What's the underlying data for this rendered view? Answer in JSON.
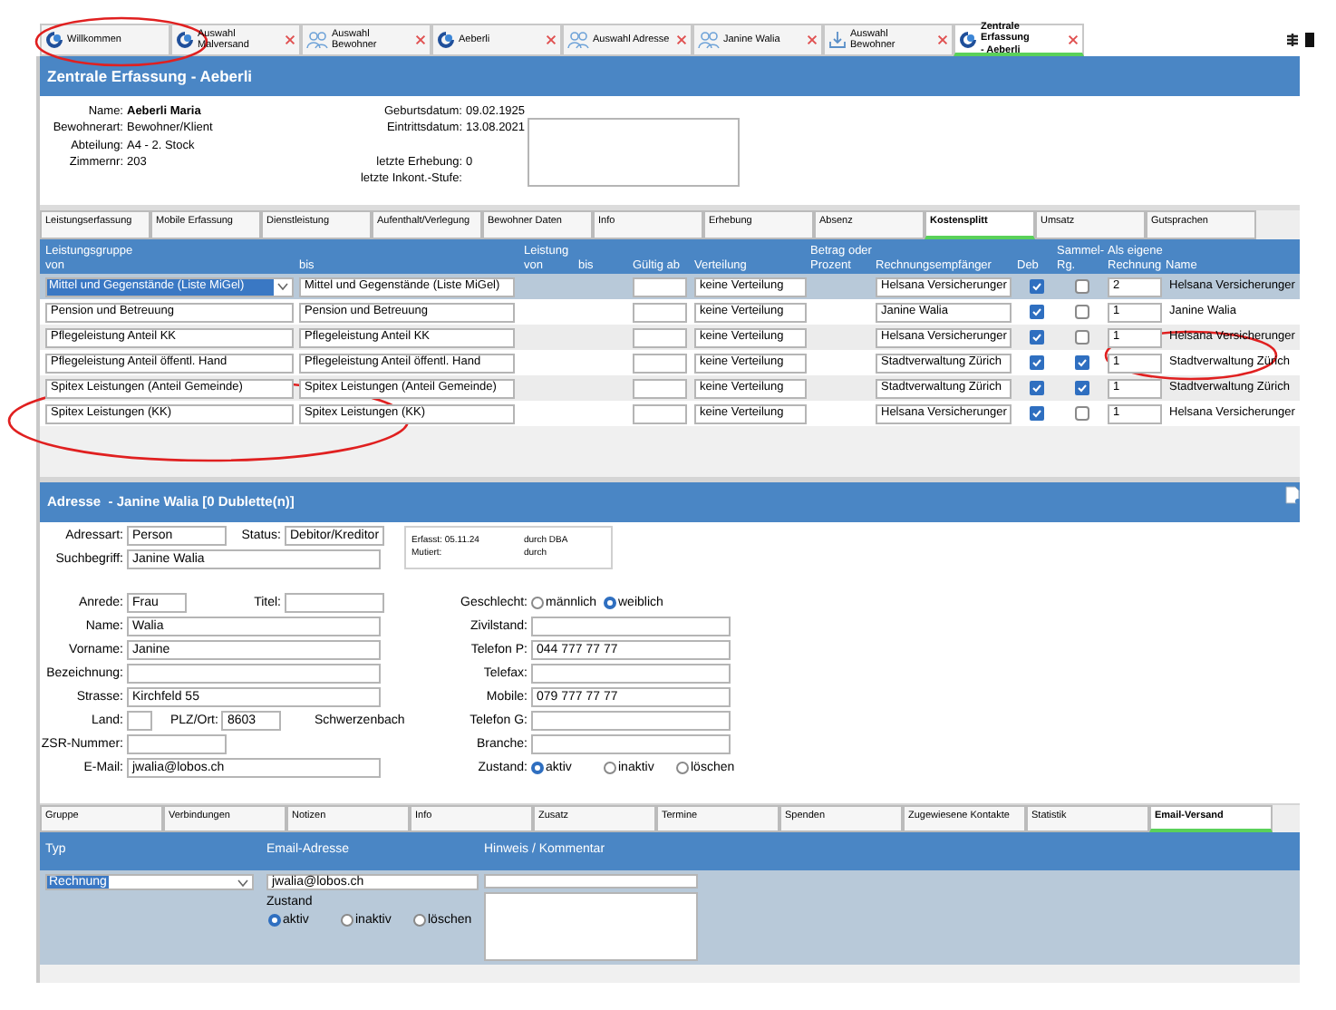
{
  "tabs": [
    {
      "label": "Willkommen",
      "kind": "swirl",
      "closable": false,
      "selected": false
    },
    {
      "label": "Auswahl Malversand",
      "kind": "swirl",
      "closable": true,
      "selected": false
    },
    {
      "label": "Auswahl Bewohner",
      "kind": "people",
      "closable": true,
      "selected": false
    },
    {
      "label": "Aeberli",
      "kind": "swirl",
      "closable": true,
      "selected": false
    },
    {
      "label": "Auswahl Adresse",
      "kind": "people",
      "closable": true,
      "selected": false
    },
    {
      "label": "Janine Walia",
      "kind": "people",
      "closable": true,
      "selected": false
    },
    {
      "label": "Auswahl Bewohner",
      "kind": "arrow",
      "closable": true,
      "selected": false
    },
    {
      "label": "Zentrale Erfassung\n- Aeberli",
      "kind": "swirl",
      "closable": true,
      "selected": true
    }
  ],
  "header": {
    "title": "Zentrale Erfassung - Aeberli",
    "person": [
      {
        "label": "Name:",
        "value": "Aeberli Maria"
      },
      {
        "label": "Bewohnerart:",
        "value": "Bewohner/Klient"
      },
      {
        "label": "Abteilung:",
        "value": "A4 - 2. Stock"
      },
      {
        "label": "Zimmernr:",
        "value": "203"
      }
    ],
    "dates": [
      {
        "label": "Geburtsdatum:",
        "value": "09.02.1925"
      },
      {
        "label": "Eintrittsdatum:",
        "value": "13.08.2021"
      },
      {
        "label": "letzte Erhebung:",
        "value": "0"
      },
      {
        "label": "letzte Inkont.-Stufe:"
      }
    ]
  },
  "subtabs": [
    {
      "label": "Leistungserfassung",
      "selected": false
    },
    {
      "label": "Mobile Erfassung",
      "selected": false
    },
    {
      "label": "Dienstleistung",
      "selected": false
    },
    {
      "label": "Aufenthalt/Verlegung",
      "selected": false
    },
    {
      "label": "Bewohner Daten",
      "selected": false
    },
    {
      "label": "Info",
      "selected": false
    },
    {
      "label": "Erhebung",
      "selected": false
    },
    {
      "label": "Absenz",
      "selected": false
    },
    {
      "label": "Kostensplitt",
      "selected": true
    },
    {
      "label": "Umsatz",
      "selected": false
    },
    {
      "label": "Gutsprachen",
      "selected": false
    }
  ],
  "cost_table": {
    "columns": [
      "Leistungsgruppe\nvon",
      "bis",
      "Leistung\nvon",
      "bis",
      "Gültig ab",
      "Verteilung",
      "Betrag oder\nProzent",
      "Rechnungsempfänger",
      "Deb",
      "Sammel-\nRg.",
      "Als eigene\nRechnung",
      "Name"
    ],
    "rows": [
      {
        "selected": true,
        "von": "Mittel und Gegenstände (Liste MiGel)",
        "bis": "Mittel und Gegenstände (Liste MiGel)",
        "verteilung": "keine Verteilung",
        "empfaenger": "Helsana Versicherunger",
        "deb": true,
        "sammel": false,
        "eigene": "2",
        "name": "Helsana Versicherunger"
      },
      {
        "selected": false,
        "von": "Pension und Betreuung",
        "bis": "Pension und Betreuung",
        "verteilung": "keine Verteilung",
        "empfaenger": "Janine Walia",
        "deb": true,
        "sammel": false,
        "eigene": "1",
        "name": "Janine Walia"
      },
      {
        "selected": false,
        "von": "Pflegeleistung Anteil KK",
        "bis": "Pflegeleistung Anteil KK",
        "verteilung": "keine Verteilung",
        "empfaenger": "Helsana Versicherunger",
        "deb": true,
        "sammel": false,
        "eigene": "1",
        "name": "Helsana Versicherunger"
      },
      {
        "selected": false,
        "von": "Pflegeleistung Anteil öffentl. Hand",
        "bis": "Pflegeleistung Anteil öffentl. Hand",
        "verteilung": "keine Verteilung",
        "empfaenger": "Stadtverwaltung Zürich",
        "deb": true,
        "sammel": true,
        "eigene": "1",
        "name": "Stadtverwaltung Zürich"
      },
      {
        "selected": false,
        "von": "Spitex Leistungen (Anteil Gemeinde)",
        "bis": "Spitex Leistungen (Anteil Gemeinde)",
        "verteilung": "keine Verteilung",
        "empfaenger": "Stadtverwaltung Zürich",
        "deb": true,
        "sammel": true,
        "eigene": "1",
        "name": "Stadtverwaltung Zürich"
      },
      {
        "selected": false,
        "von": "Spitex Leistungen (KK)",
        "bis": "Spitex Leistungen (KK)",
        "verteilung": "keine Verteilung",
        "empfaenger": "Helsana Versicherunger",
        "deb": true,
        "sammel": false,
        "eigene": "1",
        "name": "Helsana Versicherunger"
      }
    ]
  },
  "address": {
    "title": "Adresse  - Janine Walia [0 Dublette(n)]",
    "top_rows": [
      [
        {
          "kind": "field",
          "label": "Adressart:",
          "value": "Person"
        },
        {
          "kind": "field",
          "label": "Status:",
          "value": "Debitor/Kreditor"
        }
      ],
      [
        {
          "kind": "field",
          "label": "Suchbegriff:",
          "value": "Janine Walia"
        }
      ]
    ],
    "meta": [
      {
        "label": "Erfasst: 05.11.24",
        "by": "durch DBA"
      },
      {
        "label": "Mutiert:",
        "by": "durch"
      }
    ],
    "left_rows": [
      [
        {
          "kind": "field",
          "label": "Anrede:",
          "value": "Frau"
        },
        {
          "kind": "field",
          "label": "Titel:"
        }
      ],
      [
        {
          "kind": "field",
          "label": "Name:",
          "value": "Walia"
        }
      ],
      [
        {
          "kind": "field",
          "label": "Vorname:",
          "value": "Janine"
        }
      ],
      [
        {
          "kind": "field",
          "label": "Bezeichnung:"
        }
      ],
      [
        {
          "kind": "field",
          "label": "Strasse:",
          "value": "Kirchfeld 55"
        }
      ],
      [
        {
          "kind": "field",
          "label": "Land:"
        },
        {
          "kind": "field",
          "label": "PLZ/Ort:",
          "value": "8603"
        },
        {
          "kind": "text",
          "value": "Schwerzenbach"
        }
      ],
      [
        {
          "kind": "field",
          "label": "ZSR-Nummer:"
        }
      ],
      [
        {
          "kind": "field",
          "label": "E-Mail:",
          "value": "jwalia@lobos.ch"
        }
      ]
    ],
    "right_rows": [
      {
        "kind": "radio",
        "label": "Geschlecht:",
        "options": [
          {
            "label": "männlich",
            "selected": false
          },
          {
            "label": "weiblich",
            "selected": true
          }
        ]
      },
      {
        "kind": "field",
        "label": "Zivilstand:"
      },
      {
        "kind": "field",
        "label": "Telefon P:",
        "value": "044 777 77 77"
      },
      {
        "kind": "field",
        "label": "Telefax:"
      },
      {
        "kind": "field",
        "label": "Mobile:",
        "value": "079 777 77 77"
      },
      {
        "kind": "field",
        "label": "Telefon G:"
      },
      {
        "kind": "field",
        "label": "Branche:"
      },
      {
        "kind": "radio",
        "label": "Zustand:",
        "options": [
          {
            "label": "aktiv",
            "selected": true
          },
          {
            "label": "inaktiv",
            "selected": false
          },
          {
            "label": "löschen",
            "selected": false
          }
        ]
      }
    ]
  },
  "contact_tabs": [
    {
      "label": "Gruppe",
      "selected": false
    },
    {
      "label": "Verbindungen",
      "selected": false
    },
    {
      "label": "Notizen",
      "selected": false
    },
    {
      "label": "Info",
      "selected": false
    },
    {
      "label": "Zusatz",
      "selected": false
    },
    {
      "label": "Termine",
      "selected": false
    },
    {
      "label": "Spenden",
      "selected": false
    },
    {
      "label": "Zugewiesene Kontakte",
      "selected": false
    },
    {
      "label": "Statistik",
      "selected": false
    },
    {
      "label": "Email-Versand",
      "selected": true
    }
  ],
  "email": {
    "columns": [
      "Typ",
      "Email-Adresse",
      "Hinweis / Kommentar"
    ],
    "type": "Rechnung",
    "address": "jwalia@lobos.ch",
    "status_label": "Zustand",
    "status": [
      {
        "label": "aktiv",
        "selected": true
      },
      {
        "label": "inaktiv",
        "selected": false
      },
      {
        "label": "löschen",
        "selected": false
      }
    ]
  }
}
